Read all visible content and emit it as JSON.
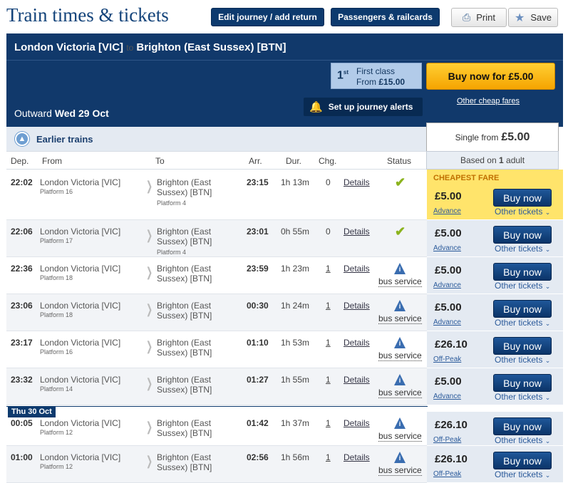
{
  "page_title": "Train times & tickets",
  "top_buttons": {
    "edit": "Edit journey / add return",
    "passengers": "Passengers & railcards",
    "print": "Print",
    "save": "Save"
  },
  "journey": {
    "from": "London Victoria [VIC]",
    "connector": "to",
    "to": "Brighton (East Sussex) [BTN]"
  },
  "first_class": {
    "superscript": "st",
    "number": "1",
    "label": "First class",
    "from": "From",
    "price": "£15.00"
  },
  "buy_now": "Buy now for £5.00",
  "other_cheap": "Other cheap fares",
  "outward": {
    "label": "Outward",
    "date": "Wed 29 Oct"
  },
  "alerts": "Set up journey alerts",
  "earlier": "Earlier trains",
  "single": {
    "label": "Single from",
    "price": "£5.00"
  },
  "based": {
    "pre": "Based on",
    "count": "1",
    "post": "adult"
  },
  "columns": {
    "dep": "Dep.",
    "from": "From",
    "to": "To",
    "arr": "Arr.",
    "dur": "Dur.",
    "chg": "Chg.",
    "status": "Status"
  },
  "day2": "Thu 30 Oct",
  "cheapest": "CHEAPEST FARE",
  "details": "Details",
  "bus": "bus service",
  "other_tickets": "Other tickets",
  "buy": "Buy now",
  "trains": [
    {
      "dep": "22:02",
      "from": "London Victoria [VIC]",
      "from_plat": "Platform 16",
      "to1": "Brighton (East",
      "to2": "Sussex) [BTN]",
      "to_plat": "Platform 4",
      "arr": "23:15",
      "dur": "1h 13m",
      "chg": "0",
      "status": "ok",
      "price": "£5.00",
      "ftype": "Advance"
    },
    {
      "dep": "22:06",
      "from": "London Victoria [VIC]",
      "from_plat": "Platform 17",
      "to1": "Brighton (East",
      "to2": "Sussex) [BTN]",
      "to_plat": "Platform 4",
      "arr": "23:01",
      "dur": "0h 55m",
      "chg": "0",
      "status": "ok",
      "price": "£5.00",
      "ftype": "Advance"
    },
    {
      "dep": "22:36",
      "from": "London Victoria [VIC]",
      "from_plat": "Platform 18",
      "to1": "Brighton (East",
      "to2": "Sussex) [BTN]",
      "to_plat": "",
      "arr": "23:59",
      "dur": "1h 23m",
      "chg": "1",
      "status": "bus",
      "price": "£5.00",
      "ftype": "Advance"
    },
    {
      "dep": "23:06",
      "from": "London Victoria [VIC]",
      "from_plat": "Platform 18",
      "to1": "Brighton (East",
      "to2": "Sussex) [BTN]",
      "to_plat": "",
      "arr": "00:30",
      "dur": "1h 24m",
      "chg": "1",
      "status": "bus",
      "price": "£5.00",
      "ftype": "Advance"
    },
    {
      "dep": "23:17",
      "from": "London Victoria [VIC]",
      "from_plat": "Platform 16",
      "to1": "Brighton (East",
      "to2": "Sussex) [BTN]",
      "to_plat": "",
      "arr": "01:10",
      "dur": "1h 53m",
      "chg": "1",
      "status": "bus",
      "price": "£26.10",
      "ftype": "Off-Peak"
    },
    {
      "dep": "23:32",
      "from": "London Victoria [VIC]",
      "from_plat": "Platform 14",
      "to1": "Brighton (East",
      "to2": "Sussex) [BTN]",
      "to_plat": "",
      "arr": "01:27",
      "dur": "1h 55m",
      "chg": "1",
      "status": "bus",
      "price": "£5.00",
      "ftype": "Advance"
    },
    {
      "dep": "00:05",
      "from": "London Victoria [VIC]",
      "from_plat": "Platform 12",
      "to1": "Brighton (East",
      "to2": "Sussex) [BTN]",
      "to_plat": "",
      "arr": "01:42",
      "dur": "1h 37m",
      "chg": "1",
      "status": "bus",
      "price": "£26.10",
      "ftype": "Off-Peak"
    },
    {
      "dep": "01:00",
      "from": "London Victoria [VIC]",
      "from_plat": "Platform 12",
      "to1": "Brighton (East",
      "to2": "Sussex) [BTN]",
      "to_plat": "",
      "arr": "02:56",
      "dur": "1h 56m",
      "chg": "1",
      "status": "bus",
      "price": "£26.10",
      "ftype": "Off-Peak"
    }
  ]
}
